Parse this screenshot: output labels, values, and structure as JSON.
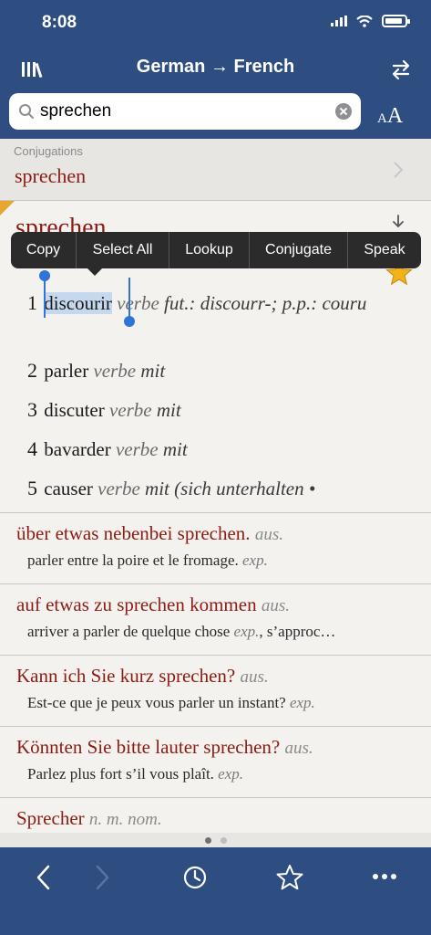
{
  "status": {
    "time": "8:08"
  },
  "nav": {
    "title": "German → French"
  },
  "search": {
    "value": "sprechen"
  },
  "font_size": {
    "small": "A",
    "big": "A"
  },
  "conjugations": {
    "label": "Conjugations",
    "word": "sprechen"
  },
  "entry": {
    "headword": "sprechen",
    "senses": [
      {
        "num": "1",
        "selected": "discourir",
        "gram": " verbe ",
        "extra": "fut.: discourr-; p.p.: couru"
      },
      {
        "num": "2",
        "word": "parler",
        "gram": " verbe ",
        "extra": "mit"
      },
      {
        "num": "3",
        "word": "discuter",
        "gram": " verbe ",
        "extra": "mit"
      },
      {
        "num": "4",
        "word": "bavarder",
        "gram": " verbe ",
        "extra": "mit"
      },
      {
        "num": "5",
        "word": "causer",
        "gram": " verbe ",
        "extra": "mit (sich unterhalten •"
      }
    ]
  },
  "context_menu": [
    "Copy",
    "Select All",
    "Lookup",
    "Conjugate",
    "Speak"
  ],
  "phrases": [
    {
      "title": "über etwas nebenbei sprechen.",
      "pos": "aus.",
      "trans": "parler entre la poire et le fromage.",
      "gram": "exp."
    },
    {
      "title": "auf etwas zu sprechen kommen",
      "pos": "aus.",
      "trans": "arriver a parler de quelque chose",
      "gram": "exp.",
      "trans_tail": ", s’approc…"
    },
    {
      "title": "Kann ich Sie kurz sprechen?",
      "pos": "aus.",
      "trans": "Est-ce que je peux vous parler un instant?",
      "gram": "exp."
    },
    {
      "title": "Könnten Sie bitte lauter sprechen?",
      "pos": "aus.",
      "trans": "Parlez plus fort s’il vous plaît.",
      "gram": "exp."
    },
    {
      "title": "Sprecher",
      "pos": "n. m. nom.",
      "trans": "",
      "gram": ""
    }
  ],
  "colors": {
    "bar": "#2e4d80",
    "headword": "#8c1c13",
    "selection": "#c6d8ee",
    "star": "#f2b31a"
  },
  "icons": [
    "library-icon",
    "swap-icon",
    "search-icon",
    "clear-icon",
    "chevron-right-icon",
    "download-icon",
    "star-icon",
    "back-icon",
    "forward-icon",
    "history-icon",
    "favorites-icon",
    "more-icon"
  ]
}
